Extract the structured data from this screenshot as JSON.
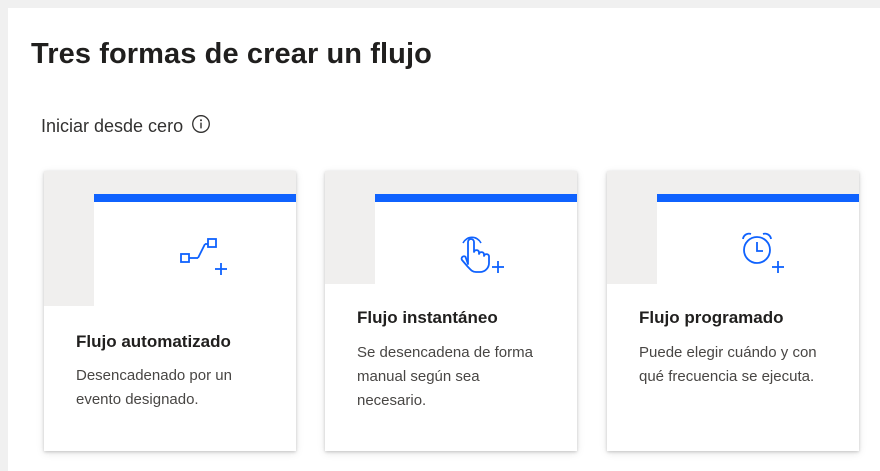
{
  "header": {
    "title": "Tres formas de crear un flujo",
    "section_label": "Iniciar desde cero"
  },
  "cards": [
    {
      "icon": "automated-flow-icon",
      "title": "Flujo automatizado",
      "description": "Desencadenado por un evento designado."
    },
    {
      "icon": "instant-flow-icon",
      "title": "Flujo instantáneo",
      "description": "Se desencadena de forma manual según sea necesario."
    },
    {
      "icon": "scheduled-flow-icon",
      "title": "Flujo programado",
      "description": "Puede elegir cuándo y con qué frecuencia se ejecuta."
    }
  ],
  "colors": {
    "accent": "#0f62fe",
    "graphic_background": "#f0efee"
  }
}
